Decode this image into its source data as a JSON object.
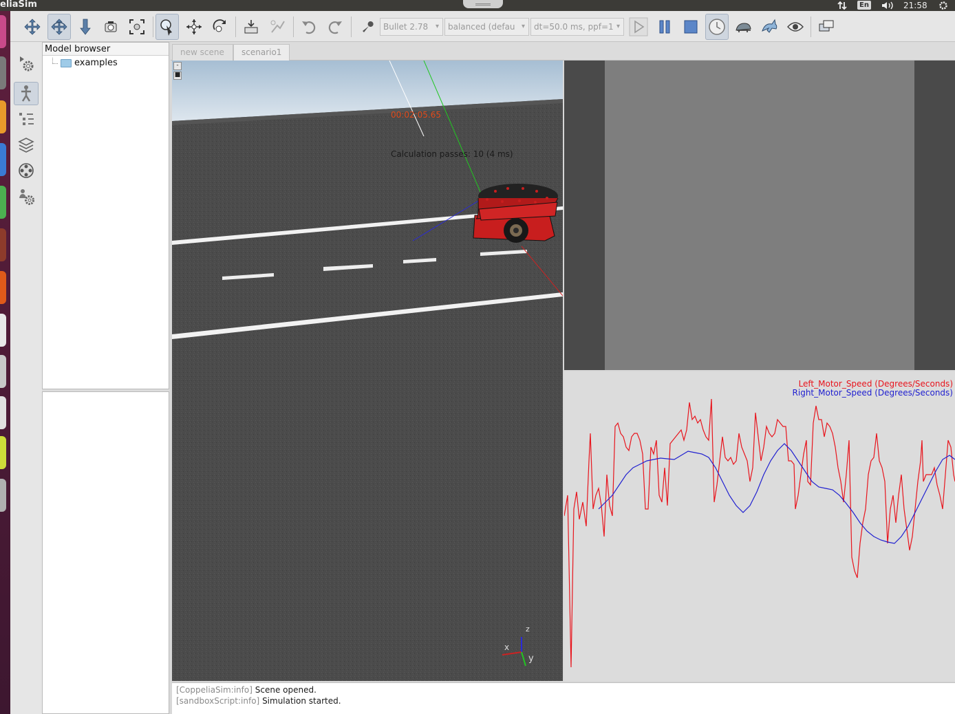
{
  "window": {
    "title": "eliaSim"
  },
  "system_tray": {
    "network_icon": "network-arrows-icon",
    "keyboard_layout": "En",
    "volume_icon": "volume-icon",
    "clock": "21:58",
    "settings_icon": "gear-icon"
  },
  "toolbar": {
    "buttons": [
      {
        "name": "camera-pan-icon"
      },
      {
        "name": "camera-rotate-icon",
        "active": true
      },
      {
        "name": "camera-shift-icon"
      },
      {
        "name": "camera-angle-icon"
      },
      {
        "name": "fit-to-view-icon"
      },
      {
        "name": "click-select-icon",
        "active": true
      },
      {
        "name": "object-shift-icon"
      },
      {
        "name": "object-rotate-icon"
      },
      {
        "name": "assemble-icon"
      },
      {
        "name": "transfer-dna-icon"
      },
      {
        "name": "undo-icon"
      },
      {
        "name": "redo-icon"
      },
      {
        "name": "dynamics-engine-icon"
      },
      {
        "name": "start-simulation-icon"
      },
      {
        "name": "pause-simulation-icon"
      },
      {
        "name": "stop-simulation-icon"
      },
      {
        "name": "realtime-mode-icon",
        "active": true
      },
      {
        "name": "slower-icon"
      },
      {
        "name": "faster-icon"
      },
      {
        "name": "visualization-toggle-icon"
      },
      {
        "name": "page-selector-icon"
      }
    ],
    "physics_engine": "Bullet 2.78",
    "engine_settings": "balanced (defau",
    "time_step": "dt=50.0 ms, ppf=1"
  },
  "side_toolbar": {
    "buttons": [
      {
        "name": "simulation-settings-icon"
      },
      {
        "name": "model-browser-icon",
        "active": true
      },
      {
        "name": "scene-hierarchy-icon"
      },
      {
        "name": "layers-icon"
      },
      {
        "name": "video-recorder-icon"
      },
      {
        "name": "user-settings-icon"
      }
    ]
  },
  "model_browser": {
    "title": "Model browser",
    "items": [
      {
        "label": "examples"
      }
    ]
  },
  "tabs": [
    {
      "label": "new scene",
      "active": false
    },
    {
      "label": "scenario1",
      "active": true
    }
  ],
  "scene_view": {
    "simulation_time": "00:02:05.65",
    "calculation_passes": "Calculation passes: 10 (4 ms)",
    "axis_labels": {
      "x": "x",
      "y": "y",
      "z": "z"
    },
    "view_controls": [
      "-",
      "■"
    ]
  },
  "graph": {
    "legend": [
      {
        "label": "Left_Motor_Speed (Degrees/Seconds)",
        "color": "#e8141c"
      },
      {
        "label": "Right_Motor_Speed (Degrees/Seconds)",
        "color": "#2020d0"
      }
    ]
  },
  "console": {
    "lines": [
      {
        "prefix": "[CoppeliaSim:info]",
        "message": " Scene opened."
      },
      {
        "prefix": "[sandboxScript:info]",
        "message": " Simulation started."
      }
    ]
  }
}
